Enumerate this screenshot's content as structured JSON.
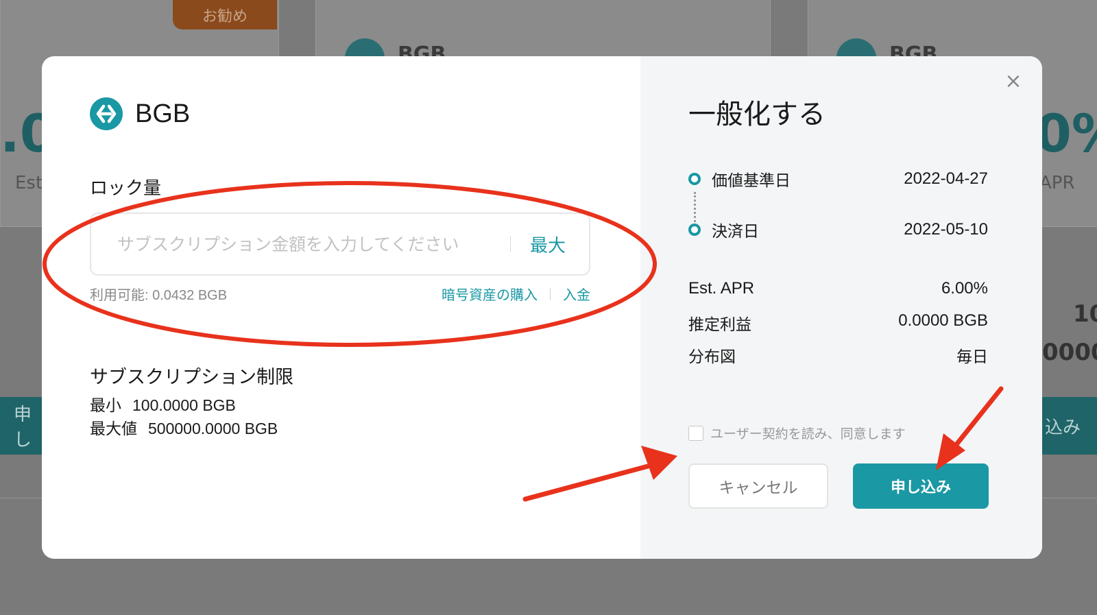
{
  "background": {
    "badge": "お勧め",
    "card_names": [
      "BGB",
      "BGB"
    ],
    "left_big": ".0",
    "right_big": "0%",
    "left_small": "Est",
    "right_small": "APR",
    "left_button": "申し",
    "right_button": "込み",
    "right_num_1": "10",
    "right_num_2": "0000"
  },
  "modal": {
    "coin_icon": "bitget-swap-icon",
    "coin_name": "BGB",
    "lock_label": "ロック量",
    "amount_input": {
      "value": "",
      "placeholder": "サブスクリプション金額を入力してください"
    },
    "max_label": "最大",
    "available": "利用可能: 0.0432 BGB",
    "buy_crypto_link": "暗号資産の購入",
    "deposit_link": "入金",
    "limit_title": "サブスクリプション制限",
    "limits": [
      {
        "label": "最小",
        "value": "100.0000 BGB"
      },
      {
        "label": "最大値",
        "value": "500000.0000 BGB"
      }
    ],
    "close_icon": "close-icon"
  },
  "summary": {
    "title": "一般化する",
    "timeline": [
      {
        "label": "価値基準日",
        "date": "2022-04-27"
      },
      {
        "label": "決済日",
        "date": "2022-05-10"
      }
    ],
    "details": [
      {
        "label": "Est. APR",
        "value": "6.00%"
      },
      {
        "label": "推定利益",
        "value": "0.0000 BGB"
      },
      {
        "label": "分布図",
        "value": "毎日"
      }
    ],
    "agreement_label": "ユーザー契約を読み、同意します",
    "cancel_label": "キャンセル",
    "apply_label": "申し込み"
  },
  "colors": {
    "accent": "#1a98a4",
    "annotation": "#e8321c"
  }
}
